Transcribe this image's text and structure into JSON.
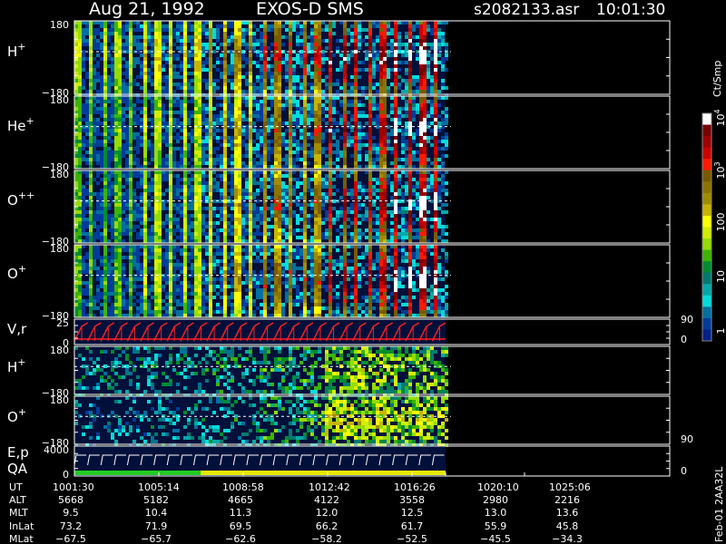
{
  "header": {
    "date": "Aug 21, 1992",
    "instrument": "EXOS-D SMS",
    "file": "s2082133.asr",
    "time": "10:01:30"
  },
  "panels": [
    {
      "label": "H",
      "sup": "+",
      "ytop": "180",
      "ybot": "−180"
    },
    {
      "label": "He",
      "sup": "+",
      "ytop": "180",
      "ybot": "−180"
    },
    {
      "label": "O",
      "sup": "++",
      "ytop": "180",
      "ybot": "−180"
    },
    {
      "label": "O",
      "sup": "+",
      "ytop": "180",
      "ybot": "−180"
    },
    {
      "label": "V,r",
      "sup": "",
      "ytop": "25",
      "ybot": "0",
      "rtop": "90",
      "rbot": "0"
    },
    {
      "label": "H",
      "sup": "+",
      "ytop": "180",
      "ybot": "−180"
    },
    {
      "label": "O",
      "sup": "+",
      "ytop": "180",
      "ybot": "−180",
      "rbot": "90"
    },
    {
      "label": "E,p",
      "label2": "QA",
      "sup": "",
      "ytop": "4000",
      "ybot": "0",
      "rbot": "0"
    }
  ],
  "colorbar": {
    "unit": "Ct/Smp",
    "labels": [
      {
        "base": "10",
        "exp": "4"
      },
      {
        "base": "10",
        "exp": "3"
      },
      {
        "base": "100",
        "exp": ""
      },
      {
        "base": "10",
        "exp": ""
      },
      {
        "base": "1",
        "exp": ""
      }
    ],
    "colors": [
      "#ffffff",
      "#7a0000",
      "#a00000",
      "#cc0000",
      "#ff1a00",
      "#7a5a00",
      "#8c7400",
      "#a08c00",
      "#c8b400",
      "#ffff00",
      "#d2ee00",
      "#96dc00",
      "#3cb400",
      "#008c30",
      "#007a70",
      "#00aaaa",
      "#00dcdc",
      "#0070a0",
      "#003c9a",
      "#00208c"
    ]
  },
  "orbit_table": {
    "row_labels": [
      "UT",
      "ALT",
      "MLT",
      "InLat",
      "MLat"
    ],
    "columns": [
      [
        "1001:30",
        "5668",
        "9.5",
        "73.2",
        "−67.5"
      ],
      [
        "1005:14",
        "5182",
        "10.4",
        "71.9",
        "−65.7"
      ],
      [
        "1008:58",
        "4665",
        "11.3",
        "69.5",
        "−62.6"
      ],
      [
        "1012:42",
        "4122",
        "12.0",
        "66.2",
        "−58.2"
      ],
      [
        "1016:26",
        "3558",
        "12.5",
        "61.7",
        "−52.5"
      ],
      [
        "1020:10",
        "2980",
        "13.0",
        "55.9",
        "−45.5"
      ],
      [
        "1025:06",
        "2216",
        "13.6",
        "45.8",
        "−34.3"
      ]
    ]
  },
  "footer_id": "Feb-01 2AA32L",
  "chart_data": {
    "type": "heatmap",
    "title": "Aug 21, 1992   EXOS-D SMS",
    "xlabel": "UT",
    "x_ticks": [
      "1001:30",
      "1005:14",
      "1008:58",
      "1012:42",
      "1016:26",
      "1020:10",
      "1025:06"
    ],
    "data_end_ut": "1020:10",
    "spin_stripes": 28,
    "colorscale": "log counts 1 to 10^4 (Ct/Smp)",
    "series": [
      {
        "name": "H+",
        "ylim": [
          -180,
          180
        ],
        "intensity_trend": [
          0.2,
          0.3,
          0.45,
          0.6,
          0.75,
          0.85
        ]
      },
      {
        "name": "He+",
        "ylim": [
          -180,
          180
        ],
        "intensity_trend": [
          0.1,
          0.2,
          0.35,
          0.5,
          0.7,
          0.85
        ]
      },
      {
        "name": "O++",
        "ylim": [
          -180,
          180
        ],
        "intensity_trend": [
          0.1,
          0.2,
          0.35,
          0.5,
          0.7,
          0.85
        ]
      },
      {
        "name": "O+",
        "ylim": [
          -180,
          180
        ],
        "intensity_trend": [
          0.1,
          0.2,
          0.35,
          0.5,
          0.7,
          0.85
        ]
      },
      {
        "name": "V,r",
        "ylim": [
          0,
          25
        ],
        "rlim": [
          0,
          90
        ]
      },
      {
        "name": "H+",
        "ylim": [
          -180,
          180
        ],
        "intensity_trend": [
          0.05,
          0.08,
          0.1,
          0.15,
          0.3,
          0.25
        ]
      },
      {
        "name": "O+",
        "ylim": [
          -180,
          180
        ],
        "intensity_trend": [
          0.0,
          0.05,
          0.08,
          0.15,
          0.35,
          0.3
        ]
      },
      {
        "name": "E,p / QA",
        "ylim": [
          0,
          4000
        ],
        "rlim": [
          0,
          90
        ]
      }
    ],
    "qa_bar": [
      {
        "from": "1001:30",
        "to": "1008:58",
        "color": "#22cc22"
      },
      {
        "from": "1008:58",
        "to": "1020:10",
        "color": "#e8e800"
      }
    ]
  }
}
